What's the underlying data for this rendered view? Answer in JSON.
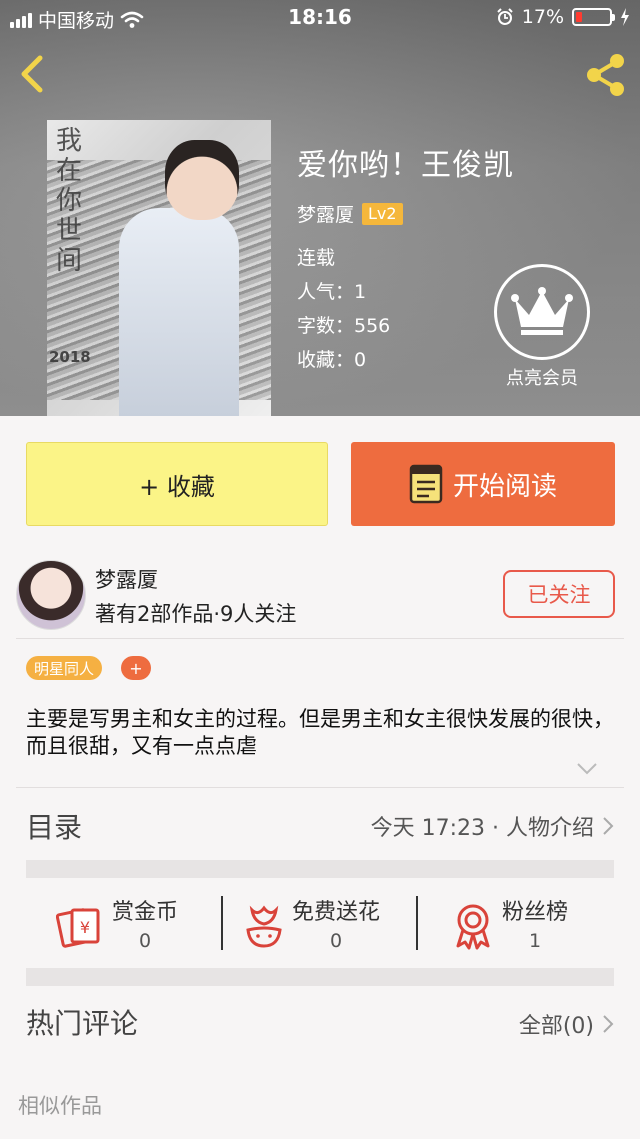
{
  "status_bar": {
    "carrier": "中国移动",
    "time": "18:16",
    "battery": "17%",
    "battery_level": 0.17
  },
  "book": {
    "title": "爱你哟！王俊凯",
    "author": "梦露厦",
    "level": "Lv2",
    "status": "连载",
    "popularity": "人气：1",
    "word_count": "字数：556",
    "favorites": "收藏：0",
    "cover": {
      "vertical_text": "我\n在\n你\n世\n间",
      "year": "2018"
    }
  },
  "vip": {
    "label": "点亮会员"
  },
  "actions": {
    "collect_label": "+ 收藏",
    "read_label": "开始阅读"
  },
  "author_card": {
    "name": "梦露厦",
    "summary": "著有2部作品·9人关注",
    "follow_label": "已关注"
  },
  "tags": {
    "items": [
      "明星同人"
    ],
    "add_label": "+"
  },
  "description": "主要是写男主和女主的过程。但是男主和女主很快发展的很快，而且很甜，又有一点点虐",
  "catalog": {
    "title": "目录",
    "latest": "今天 17:23 · 人物介绍"
  },
  "stats": [
    {
      "label": "赏金币",
      "value": "0"
    },
    {
      "label": "免费送花",
      "value": "0"
    },
    {
      "label": "粉丝榜",
      "value": "1"
    }
  ],
  "comments": {
    "title": "热门评论",
    "all_label": "全部(0)"
  },
  "similar": {
    "title": "相似作品"
  },
  "colors": {
    "accent_orange": "#ee6c3f",
    "collect_yellow": "#fbf487",
    "tag_orange": "#f5b042",
    "follow_red": "#e8594a",
    "icon_red": "#d9433a"
  }
}
